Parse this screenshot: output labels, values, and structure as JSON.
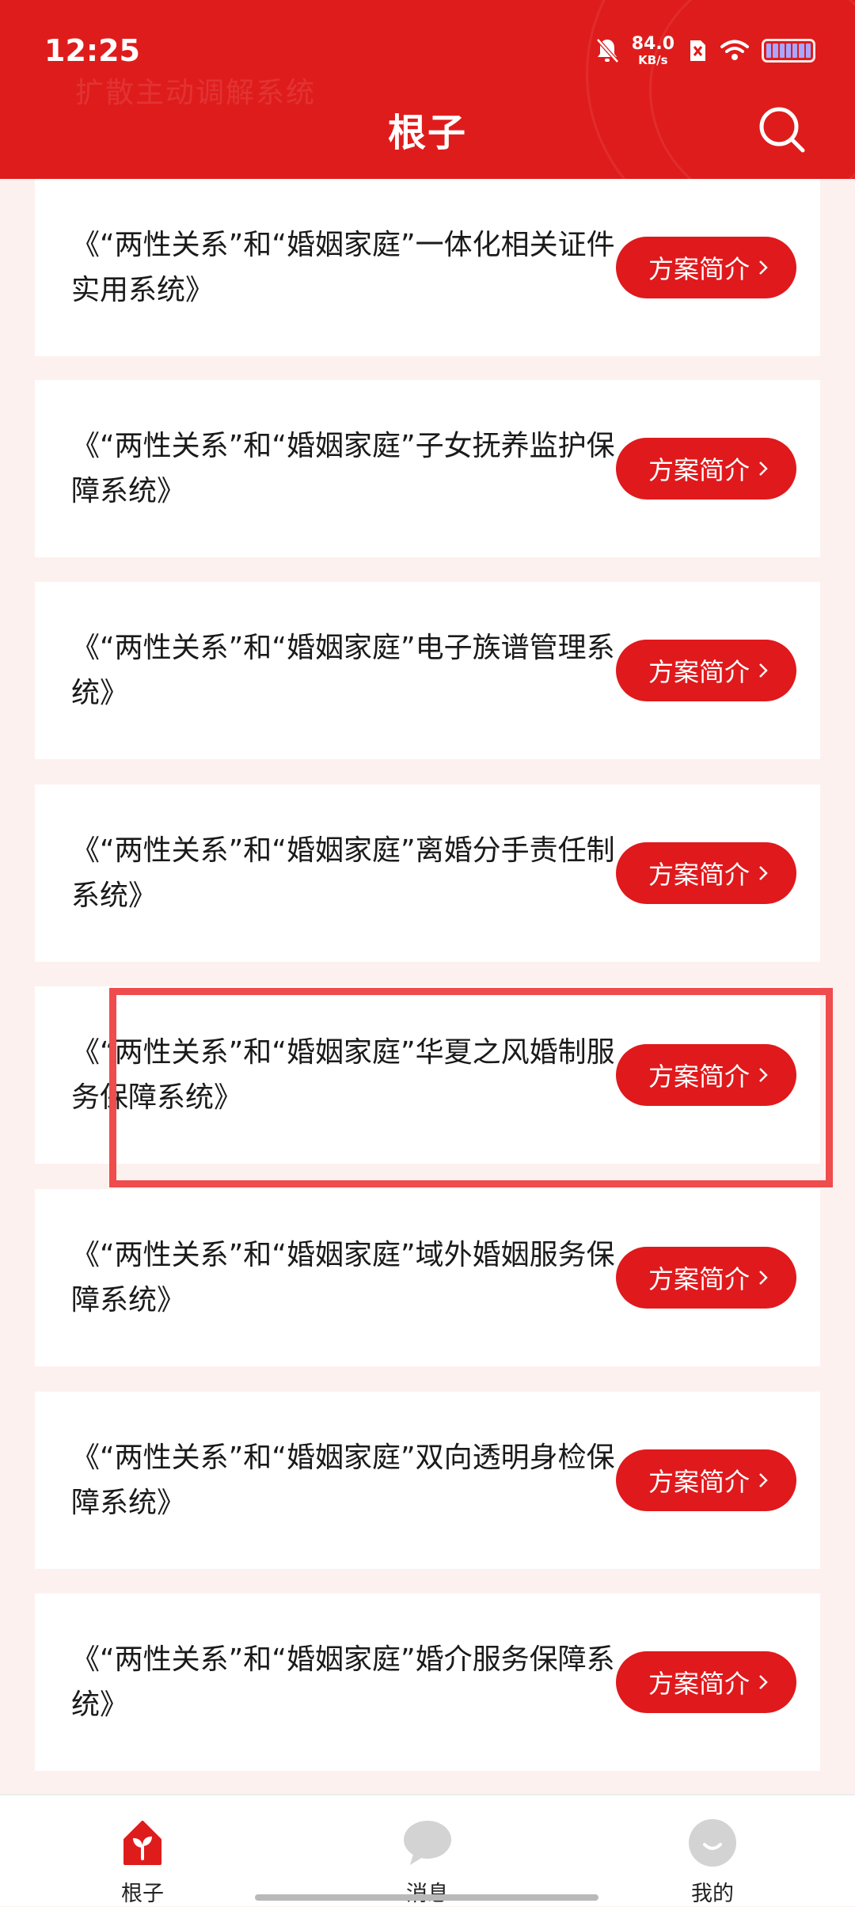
{
  "status_bar": {
    "time": "12:25",
    "net_speed_value": "84.0",
    "net_speed_unit": "KB/s"
  },
  "header": {
    "title": "根子",
    "background_faded_text": "扩散主动调解系统",
    "search_icon": "search-icon"
  },
  "list": {
    "items": [
      {
        "title": "《“两性关系”和“婚姻家庭”一体化相关证件实用系统》",
        "button_label": "方案简介"
      },
      {
        "title": "《“两性关系”和“婚姻家庭”子女抚养监护保障系统》",
        "button_label": "方案简介"
      },
      {
        "title": "《“两性关系”和“婚姻家庭”电子族谱管理系统》",
        "button_label": "方案简介"
      },
      {
        "title": "《“两性关系”和“婚姻家庭”离婚分手责任制系统》",
        "button_label": "方案简介"
      },
      {
        "title": "《“两性关系”和“婚姻家庭”华夏之风婚制服务保障系统》",
        "button_label": "方案简介"
      },
      {
        "title": "《“两性关系”和“婚姻家庭”域外婚姻服务保障系统》",
        "button_label": "方案简介"
      },
      {
        "title": "《“两性关系”和“婚姻家庭”双向透明身检保障系统》",
        "button_label": "方案简介"
      },
      {
        "title": "《“两性关系”和“婚姻家庭”婚介服务保障系统》",
        "button_label": "方案简介"
      }
    ]
  },
  "bottom_nav": {
    "items": [
      {
        "label": "根子",
        "icon": "home-sprout-icon",
        "active": true
      },
      {
        "label": "消息",
        "icon": "message-bubble-icon",
        "active": false
      },
      {
        "label": "我的",
        "icon": "profile-face-icon",
        "active": false
      }
    ]
  },
  "colors": {
    "primary_red": "#df1c1c",
    "button_red": "#e0191c",
    "highlight_border": "#ee4c4d",
    "page_background": "#fdf1ef"
  }
}
